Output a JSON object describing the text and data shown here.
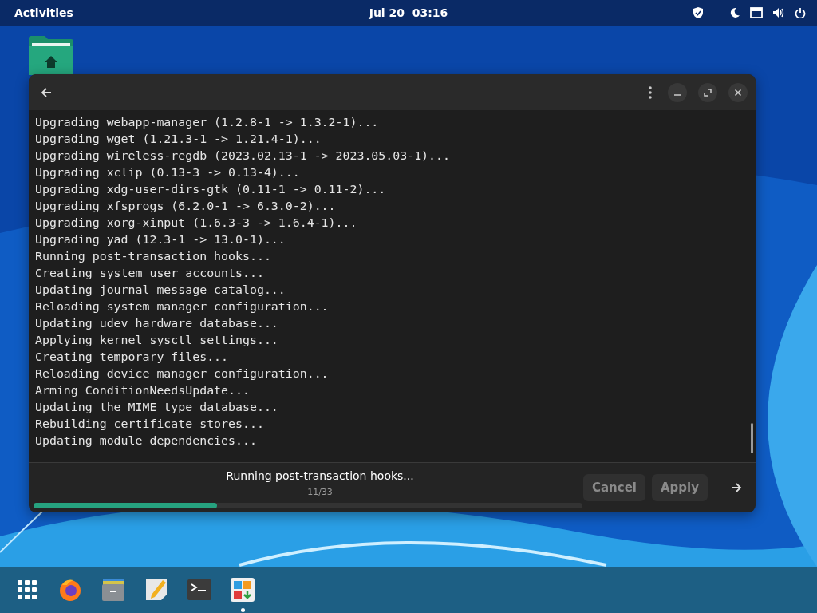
{
  "top_bar": {
    "activities": "Activities",
    "clock": "Jul 20  03:16"
  },
  "window": {
    "log_lines": [
      "Upgrading webapp-manager (1.2.8-1 -> 1.3.2-1)...",
      "Upgrading wget (1.21.3-1 -> 1.21.4-1)...",
      "Upgrading wireless-regdb (2023.02.13-1 -> 2023.05.03-1)...",
      "Upgrading xclip (0.13-3 -> 0.13-4)...",
      "Upgrading xdg-user-dirs-gtk (0.11-1 -> 0.11-2)...",
      "Upgrading xfsprogs (6.2.0-1 -> 6.3.0-2)...",
      "Upgrading xorg-xinput (1.6.3-3 -> 1.6.4-1)...",
      "Upgrading yad (12.3-1 -> 13.0-1)...",
      "Running post-transaction hooks...",
      "Creating system user accounts...",
      "Updating journal message catalog...",
      "Reloading system manager configuration...",
      "Updating udev hardware database...",
      "Applying kernel sysctl settings...",
      "Creating temporary files...",
      "Reloading device manager configuration...",
      "Arming ConditionNeedsUpdate...",
      "Updating the MIME type database...",
      "Rebuilding certificate stores...",
      "Updating module dependencies..."
    ],
    "status": "Running post-transaction hooks...",
    "count": "11/33",
    "progress": {
      "level": 0.334
    },
    "buttons": [
      {
        "label": "Cancel",
        "disabled": true
      },
      {
        "label": "Apply",
        "disabled": true
      }
    ]
  },
  "dock": [
    {
      "kind": "grid",
      "running": false
    },
    {
      "kind": "browser",
      "running": false
    },
    {
      "kind": "files",
      "running": false
    },
    {
      "kind": "editor",
      "running": false
    },
    {
      "kind": "terminal",
      "running": false
    },
    {
      "kind": "software",
      "running": true
    }
  ]
}
